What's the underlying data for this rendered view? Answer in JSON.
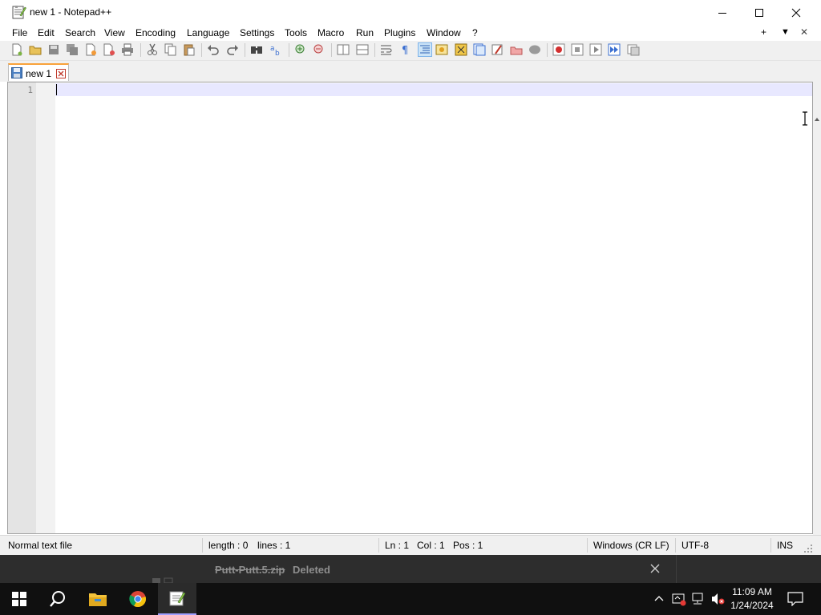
{
  "window": {
    "title": "new 1 - Notepad++"
  },
  "menu": {
    "items": [
      "File",
      "Edit",
      "Search",
      "View",
      "Encoding",
      "Language",
      "Settings",
      "Tools",
      "Macro",
      "Run",
      "Plugins",
      "Window",
      "?"
    ],
    "right": {
      "plus": "+",
      "down": "▼",
      "close": "✕"
    }
  },
  "tabs": [
    {
      "label": "new 1",
      "unsaved": true
    }
  ],
  "editor": {
    "line_numbers": [
      "1"
    ],
    "content": ""
  },
  "status": {
    "file_type": "Normal text file",
    "length": "length : 0",
    "lines": "lines : 1",
    "ln": "Ln : 1",
    "col": "Col : 1",
    "pos": "Pos : 1",
    "eol": "Windows (CR LF)",
    "encoding": "UTF-8",
    "mode": "INS"
  },
  "notification": {
    "file": "Putt-Putt.5.zip",
    "status": "Deleted"
  },
  "taskbar": {
    "time": "11:09 AM",
    "date": "1/24/2024"
  },
  "colors": {
    "current_line": "#e8e8ff",
    "tab_accent": "#f9a23a",
    "taskbar": "#101010"
  }
}
